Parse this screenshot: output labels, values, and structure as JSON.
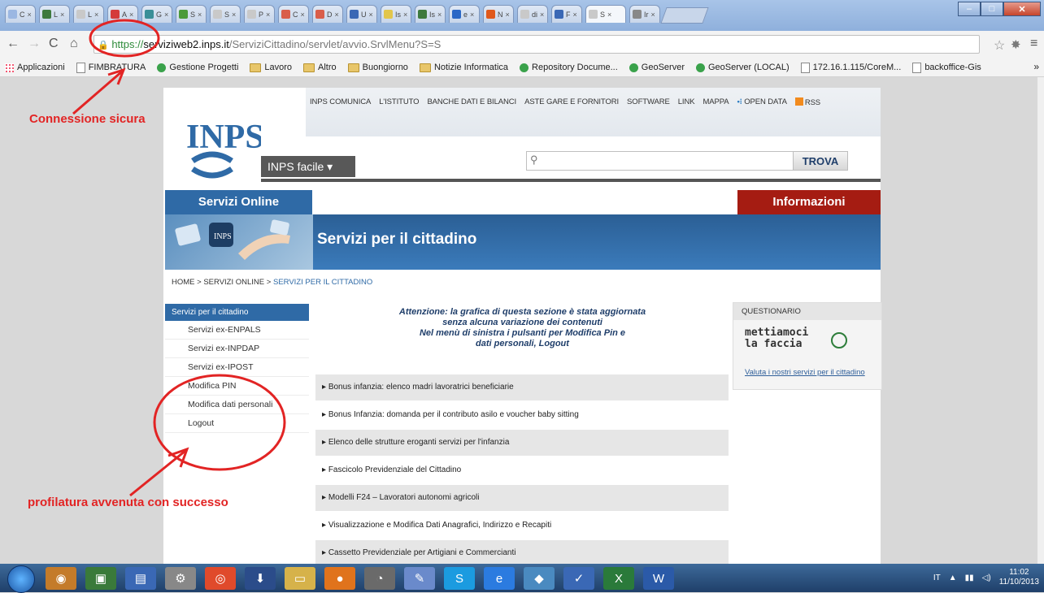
{
  "browser": {
    "tabs": [
      {
        "letter": "C",
        "color": "#9bb7e2"
      },
      {
        "letter": "L",
        "color": "#3e7a3e"
      },
      {
        "letter": "L",
        "color": "#c9c9c9"
      },
      {
        "letter": "A",
        "color": "#d43b3b"
      },
      {
        "letter": "G",
        "color": "#3a8f98"
      },
      {
        "letter": "S",
        "color": "#4a9a3a"
      },
      {
        "letter": "S",
        "color": "#c9c9c9"
      },
      {
        "letter": "P",
        "color": "#c9c9c9"
      },
      {
        "letter": "C",
        "color": "#d95e4b"
      },
      {
        "letter": "D",
        "color": "#d95e4b"
      },
      {
        "letter": "U",
        "color": "#3a68b5"
      },
      {
        "letter": "Is",
        "color": "#e2c64b"
      },
      {
        "letter": "Is",
        "color": "#3e7a3e"
      },
      {
        "letter": "e",
        "color": "#2b68c6"
      },
      {
        "letter": "N",
        "color": "#e0591c"
      },
      {
        "letter": "di",
        "color": "#c9c9c9"
      },
      {
        "letter": "F",
        "color": "#3a68b5"
      },
      {
        "letter": "S",
        "color": "#c9c9c9",
        "active": true
      },
      {
        "letter": "Ir",
        "color": "#888"
      }
    ],
    "url": {
      "scheme": "https://",
      "host": "serviziweb2.inps.it",
      "path": "/ServiziCittadino/servlet/avvio.SrvlMenu?S=S"
    },
    "bookmarks": [
      "Applicazioni",
      "FIMBRATURA",
      "Gestione Progetti",
      "Lavoro",
      "Altro",
      "Buongiorno",
      "Notizie Informatica",
      "Repository Docume...",
      "GeoServer",
      "GeoServer (LOCAL)",
      "172.16.1.115/CoreM...",
      "backoffice-Gis"
    ],
    "bookmarks_more": "»"
  },
  "site": {
    "logo_text": "INPS",
    "top_links": [
      "INPS COMUNICA",
      "L'ISTITUTO",
      "BANCHE DATI E BILANCI",
      "ASTE GARE E FORNITORI",
      "SOFTWARE",
      "LINK",
      "MAPPA",
      "OPEN DATA",
      "RSS"
    ],
    "inps_facile": "INPS facile",
    "search_button": "TROVA",
    "tab_left": "Servizi Online",
    "tab_right": "Informazioni",
    "banner_title": "Servizi per il cittadino",
    "breadcrumb": {
      "home": "HOME",
      "sep": ">",
      "level2": "SERVIZI ONLINE",
      "current": "SERVIZI PER IL CITTADINO"
    },
    "leftnav": {
      "header": "Servizi per il cittadino",
      "items": [
        "Servizi ex-ENPALS",
        "Servizi ex-INPDAP",
        "Servizi ex-IPOST",
        "Modifica PIN",
        "Modifica dati personali",
        "Logout"
      ]
    },
    "notice": [
      "Attenzione: la grafica di questa sezione è stata aggiornata",
      "senza alcuna variazione dei contenuti",
      "Nel menù di sinistra i pulsanti per Modifica Pin e",
      "dati personali, Logout"
    ],
    "services": [
      "Bonus infanzia: elenco madri lavoratrici beneficiarie",
      "Bonus Infanzia: domanda per il contributo asilo e voucher baby sitting",
      "Elenco delle strutture eroganti servizi per l'infanzia",
      "Fascicolo Previdenziale del Cittadino",
      "Modelli F24 – Lavoratori autonomi agricoli",
      "Visualizzazione e Modifica Dati Anagrafici, Indirizzo e Recapiti",
      "Cassetto Previdenziale per Artigiani e Commercianti"
    ],
    "questionnaire": {
      "title": "QUESTIONARIO",
      "brand_line1": "mettiamoci",
      "brand_line2": "la faccia",
      "link": "Valuta i nostri servizi per il cittadino"
    }
  },
  "annotations": {
    "secure": "Connessione sicura",
    "profile": "profilatura avvenuta con successo",
    "color": "#e22424"
  },
  "taskbar": {
    "lang": "IT",
    "time": "11:02",
    "date": "11/10/2013"
  }
}
